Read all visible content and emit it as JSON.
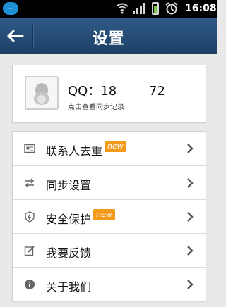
{
  "status_bar": {
    "time": "16:08",
    "notification": "…"
  },
  "header": {
    "title": "设置"
  },
  "profile": {
    "qq_label": "QQ：18        72",
    "hint": "点击查看同步记录"
  },
  "menu": {
    "items": [
      {
        "label": "联系人去重",
        "badge": "new",
        "icon": "contact-card-icon"
      },
      {
        "label": "同步设置",
        "badge": "",
        "icon": "sync-arrows-icon"
      },
      {
        "label": "安全保护",
        "badge": "new",
        "icon": "shield-icon"
      },
      {
        "label": "我要反馈",
        "badge": "",
        "icon": "edit-icon"
      },
      {
        "label": "关于我们",
        "badge": "",
        "icon": "info-icon"
      }
    ]
  },
  "colors": {
    "header": "#2a5179",
    "badge": "#f39a1b",
    "battery": "#7bc043"
  }
}
